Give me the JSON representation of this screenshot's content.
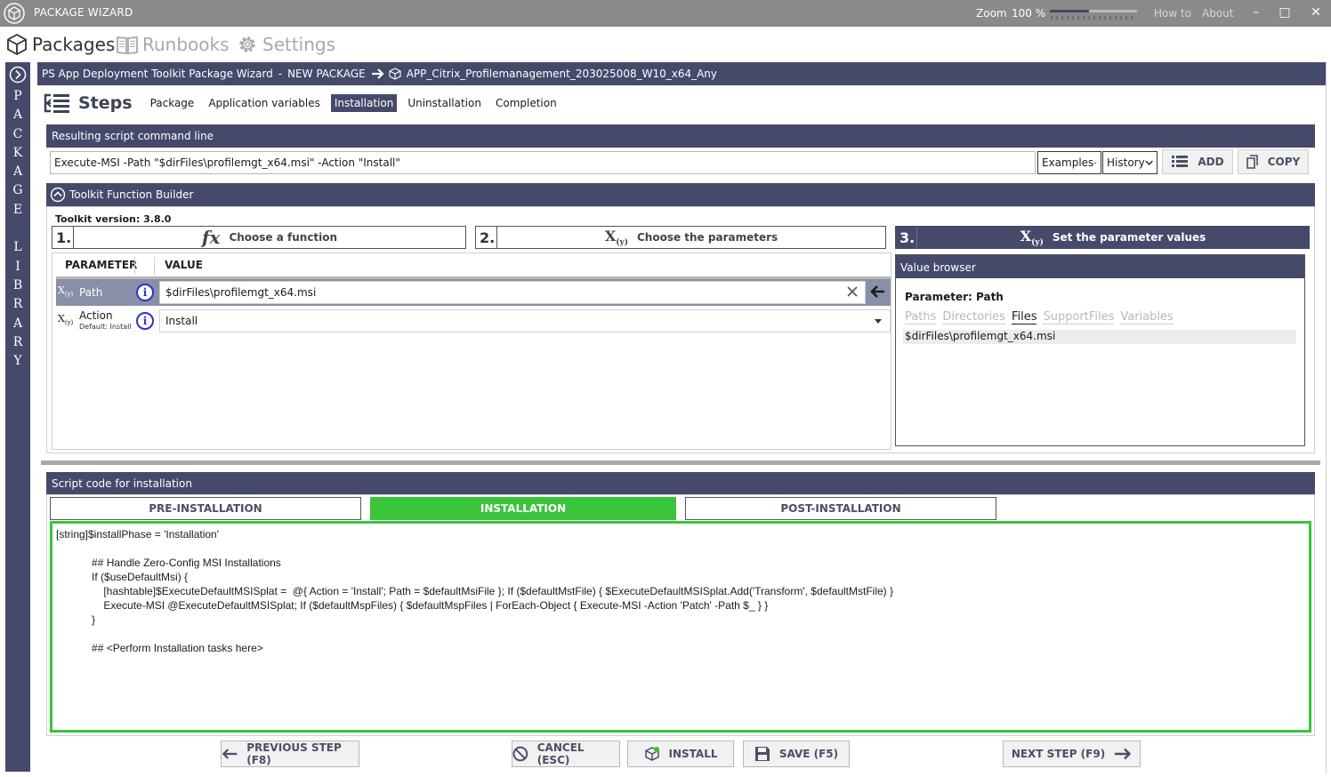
{
  "titlebar": {
    "app_title": "PACKAGE WIZARD",
    "zoom_label": "Zoom",
    "zoom_value": "100 %",
    "zoom_level_percent": 100,
    "how_to": "How to",
    "about": "About",
    "minimize": "–",
    "maximize": "□",
    "close": "✕"
  },
  "main_nav": {
    "packages": "Packages",
    "runbooks": "Runbooks",
    "settings": "Settings"
  },
  "side_strip": {
    "letters": "P\nA\nC\nK\nA\nG\nE\n\nL\nI\nB\nR\nA\nR\nY"
  },
  "breadcrumb": {
    "wizard": "PS App Deployment Toolkit Package Wizard",
    "dash": "-",
    "new_package": "NEW PACKAGE",
    "package_name": "APP_Citrix_Profilemanagement_203025008_W10_x64_Any"
  },
  "steps": {
    "title": "Steps",
    "tabs": [
      "Package",
      "Application variables",
      "Installation",
      "Uninstallation",
      "Completion"
    ],
    "active": "Installation"
  },
  "command_line": {
    "header": "Resulting script command line",
    "value": "Execute-MSI  -Path \"$dirFiles\\profilemgt_x64.msi\" -Action \"Install\"",
    "examples": "Examples",
    "history": "History",
    "add": "ADD",
    "copy": "COPY"
  },
  "builder": {
    "header": "Toolkit Function Builder",
    "toolkit_version_label": "Toolkit version:",
    "toolkit_version": "3.8.0",
    "step1_num": "1.",
    "step1_label": "Choose a function",
    "step2_num": "2.",
    "step2_label": "Choose the parameters",
    "step3_num": "3.",
    "step3_label": "Set the parameter values",
    "fx_glyph": "fx",
    "xy_glyph": "X",
    "xy_sub": "(y)",
    "col_parameter": "PARAMETER",
    "col_value": "VALUE",
    "params": [
      {
        "name": "Path",
        "value": "$dirFiles\\profilemgt_x64.msi",
        "default": ""
      },
      {
        "name": "Action",
        "value": "Install",
        "default": "Default:  Install"
      }
    ]
  },
  "value_browser": {
    "header": "Value browser",
    "parameter_label": "Parameter: Path",
    "tabs": [
      "Paths",
      "Directories",
      "Files",
      "SupportFiles",
      "Variables"
    ],
    "active_tab": "Files",
    "items": [
      "$dirFiles\\profilemgt_x64.msi"
    ]
  },
  "script": {
    "header": "Script code for installation",
    "tabs": [
      "PRE-INSTALLATION",
      "INSTALLATION",
      "POST-INSTALLATION"
    ],
    "active_tab": "INSTALLATION",
    "code": "[string]$installPhase = 'Installation'\n\n\t\t\t## Handle Zero-Config MSI Installations\n\t\t\tIf ($useDefaultMsi) {\n\t\t\t\t[hashtable]$ExecuteDefaultMSISplat =  @{ Action = 'Install'; Path = $defaultMsiFile }; If ($defaultMstFile) { $ExecuteDefaultMSISplat.Add('Transform', $defaultMstFile) }\n\t\t\t\tExecute-MSI @ExecuteDefaultMSISplat; If ($defaultMspFiles) { $defaultMspFiles | ForEach-Object { Execute-MSI -Action 'Patch' -Path $_ } }\n\t\t\t}\n\n\t\t\t## <Perform Installation tasks here>"
  },
  "footer": {
    "previous": "PREVIOUS STEP (F8)",
    "cancel": "CANCEL (ESC)",
    "install": "INSTALL",
    "save": "SAVE (F5)",
    "next": "NEXT STEP (F9)"
  },
  "colors": {
    "accent_navy": "#454a6b",
    "active_green": "#3ac43a",
    "info_blue": "#2a33c7"
  }
}
